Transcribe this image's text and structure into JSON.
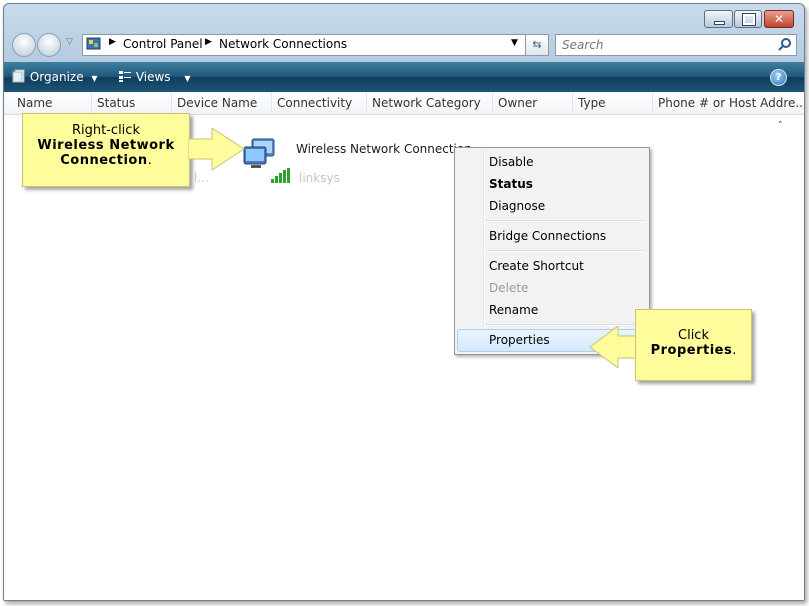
{
  "window": {
    "buttons": {
      "minimize": "minimize",
      "maximize": "maximize",
      "close": "close"
    }
  },
  "nav": {
    "back_icon": "back-arrow-icon",
    "forward_icon": "forward-arrow-icon",
    "dropdown_icon": "chevron-down-icon"
  },
  "address": {
    "path": [
      "Control Panel",
      "Network Connections"
    ],
    "icon": "control-panel-icon"
  },
  "search": {
    "placeholder": "Search"
  },
  "toolbar": {
    "organize": "Organize",
    "views": "Views",
    "help_icon": "help-icon"
  },
  "columns": [
    "Name",
    "Status",
    "Device Name",
    "Connectivity",
    "Network Category",
    "Owner",
    "Type",
    "Phone # or Host Addre..."
  ],
  "item": {
    "name": "Wireless Network Connection",
    "network": "linksys",
    "faded_text": "l..."
  },
  "context_menu": {
    "items": [
      {
        "label": "Disable",
        "bold": false,
        "disabled": false
      },
      {
        "label": "Status",
        "bold": true,
        "disabled": false
      },
      {
        "label": "Diagnose",
        "bold": false,
        "disabled": false
      },
      {
        "label": "Bridge Connections",
        "bold": false,
        "disabled": false
      },
      {
        "label": "Create Shortcut",
        "bold": false,
        "disabled": false
      },
      {
        "label": "Delete",
        "bold": false,
        "disabled": true
      },
      {
        "label": "Rename",
        "bold": false,
        "disabled": false
      },
      {
        "label": "Properties",
        "bold": false,
        "disabled": false,
        "highlighted": true
      }
    ]
  },
  "callouts": {
    "first": {
      "line1": "Right-click",
      "line2": "Wireless Network",
      "line3": "Connection",
      "period": "."
    },
    "second": {
      "line1": "Click",
      "line2": "Properties",
      "period": "."
    }
  },
  "colors": {
    "callout_bg": "#fffc9c",
    "toolbar": "#1f5576",
    "menu_highlight": "#dcebfc"
  }
}
